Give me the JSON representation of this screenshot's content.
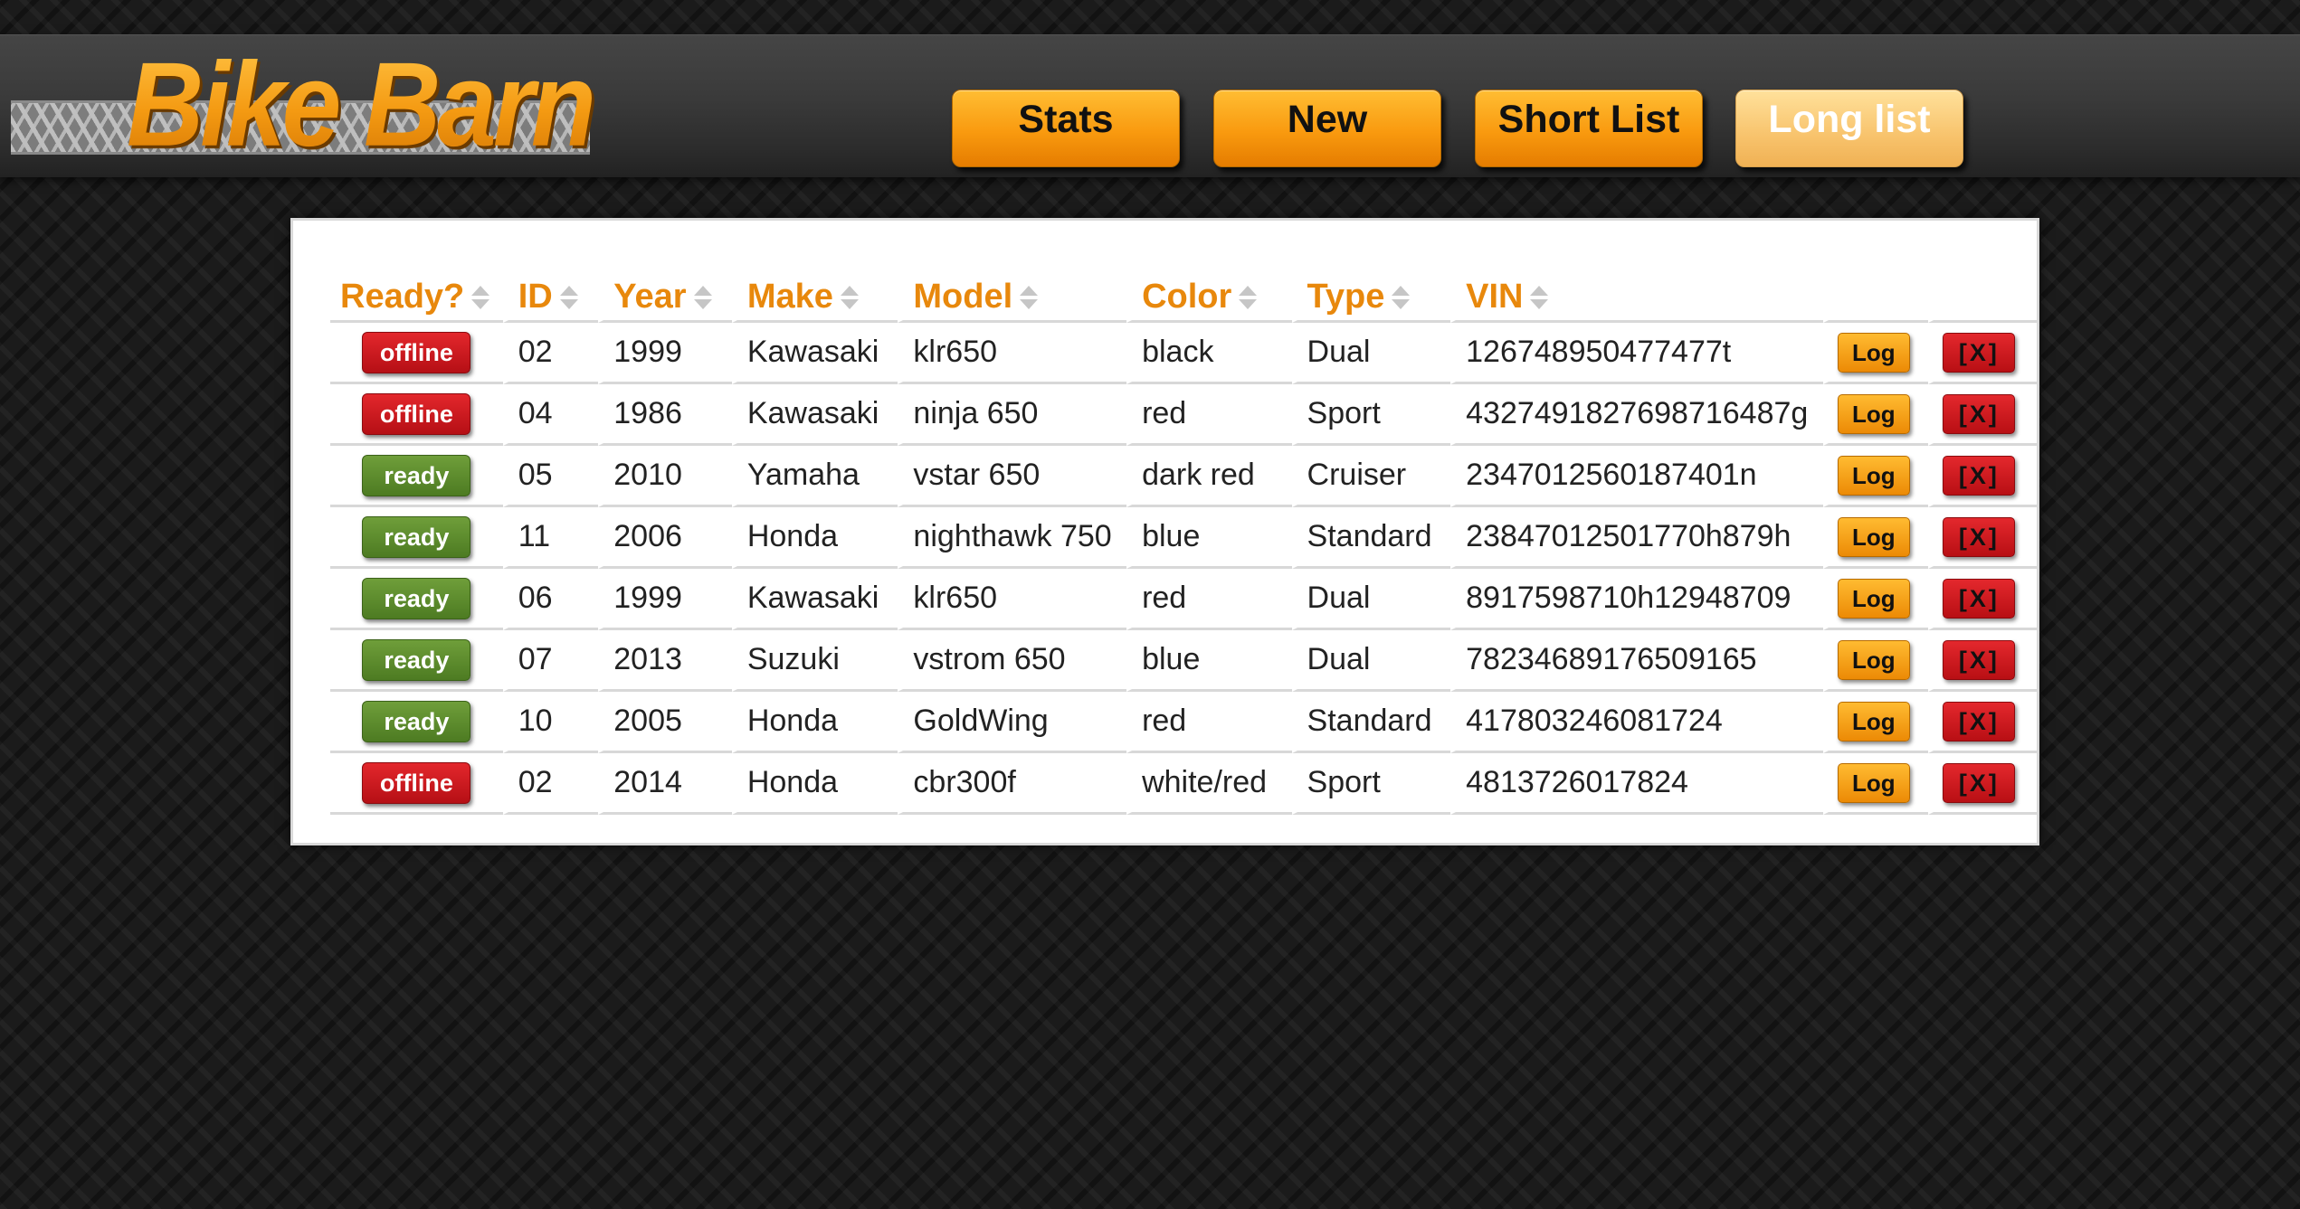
{
  "app": {
    "logo_text": "Bike Barn"
  },
  "nav": {
    "stats": "Stats",
    "new": "New",
    "short_list": "Short List",
    "long_list": "Long list",
    "active": "long_list"
  },
  "table": {
    "headers": {
      "ready": "Ready?",
      "id": "ID",
      "year": "Year",
      "make": "Make",
      "model": "Model",
      "color": "Color",
      "type": "Type",
      "vin": "VIN"
    },
    "log_label": "Log",
    "delete_label": "[X]",
    "rows": [
      {
        "status": "offline",
        "id": "02",
        "year": "1999",
        "make": "Kawasaki",
        "model": "klr650",
        "color": "black",
        "type": "Dual",
        "vin": "126748950477477t"
      },
      {
        "status": "offline",
        "id": "04",
        "year": "1986",
        "make": "Kawasaki",
        "model": "ninja 650",
        "color": "red",
        "type": "Sport",
        "vin": "4327491827698716487g"
      },
      {
        "status": "ready",
        "id": "05",
        "year": "2010",
        "make": "Yamaha",
        "model": "vstar 650",
        "color": "dark red",
        "type": "Cruiser",
        "vin": "2347012560187401n"
      },
      {
        "status": "ready",
        "id": "11",
        "year": "2006",
        "make": "Honda",
        "model": "nighthawk 750",
        "color": "blue",
        "type": "Standard",
        "vin": "23847012501770h879h"
      },
      {
        "status": "ready",
        "id": "06",
        "year": "1999",
        "make": "Kawasaki",
        "model": "klr650",
        "color": "red",
        "type": "Dual",
        "vin": "8917598710h12948709"
      },
      {
        "status": "ready",
        "id": "07",
        "year": "2013",
        "make": "Suzuki",
        "model": "vstrom 650",
        "color": "blue",
        "type": "Dual",
        "vin": "78234689176509165"
      },
      {
        "status": "ready",
        "id": "10",
        "year": "2005",
        "make": "Honda",
        "model": "GoldWing",
        "color": "red",
        "type": "Standard",
        "vin": "417803246081724"
      },
      {
        "status": "offline",
        "id": "02",
        "year": "2014",
        "make": "Honda",
        "model": "cbr300f",
        "color": "white/red",
        "type": "Sport",
        "vin": "4813726017824"
      }
    ]
  },
  "colors": {
    "accent": "#f99a0f",
    "header_text": "#e8880c",
    "ready": "#5b8a2c",
    "offline": "#c8161c"
  },
  "icons": {
    "sort": "sort-icon"
  }
}
